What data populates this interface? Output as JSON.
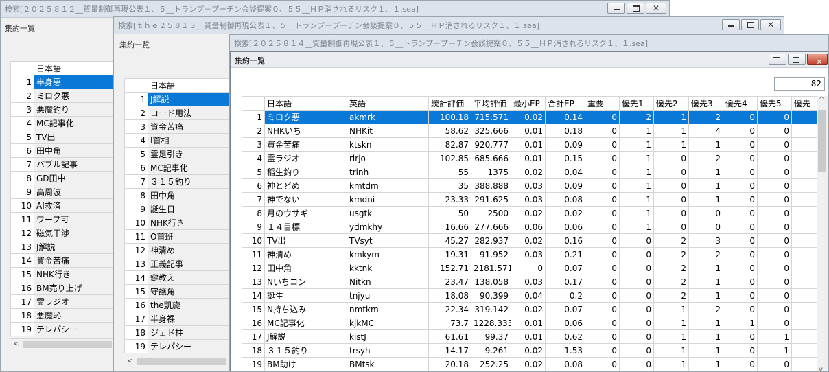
{
  "window1": {
    "title": "検索[２０２５８１２__質量制御再現公表１、５__トランプ－プーチン会談提案０、５５__ＨＰ消されるリスク１、１.sea]",
    "panel_title": "集約一覧",
    "col_header": "日本語",
    "rows": [
      {
        "n": "1",
        "ja": "半身悪"
      },
      {
        "n": "2",
        "ja": "ミロク悪"
      },
      {
        "n": "3",
        "ja": "悪魔釣り"
      },
      {
        "n": "4",
        "ja": "MC記事化"
      },
      {
        "n": "5",
        "ja": "TV出"
      },
      {
        "n": "6",
        "ja": "田中角"
      },
      {
        "n": "7",
        "ja": "バブル記事"
      },
      {
        "n": "8",
        "ja": "GD田中"
      },
      {
        "n": "9",
        "ja": "高周波"
      },
      {
        "n": "10",
        "ja": "AI救済"
      },
      {
        "n": "11",
        "ja": "ワープ可"
      },
      {
        "n": "12",
        "ja": "磁気干渉"
      },
      {
        "n": "13",
        "ja": "J解説"
      },
      {
        "n": "14",
        "ja": "資金苦痛"
      },
      {
        "n": "15",
        "ja": "NHK行き"
      },
      {
        "n": "16",
        "ja": "BM売り上げ"
      },
      {
        "n": "17",
        "ja": "霊ラジオ"
      },
      {
        "n": "18",
        "ja": "悪魔恥"
      },
      {
        "n": "19",
        "ja": "テレパシー"
      }
    ]
  },
  "window2": {
    "title": "検索[ｔｈｅ２５８１３__質量制御再現公表１、５__トランプ－プーチン会談提案０、５５__ＨＰ消されるリスク１、１.sea]",
    "panel_title": "集約一覧",
    "col_header": "日本語",
    "rows": [
      {
        "n": "1",
        "ja": "J解説"
      },
      {
        "n": "2",
        "ja": "コード用法"
      },
      {
        "n": "3",
        "ja": "資金苦痛"
      },
      {
        "n": "4",
        "ja": "I首相"
      },
      {
        "n": "5",
        "ja": "霊足引き"
      },
      {
        "n": "6",
        "ja": "MC記事化"
      },
      {
        "n": "7",
        "ja": "３１５釣り"
      },
      {
        "n": "8",
        "ja": "田中角"
      },
      {
        "n": "9",
        "ja": "誕生日"
      },
      {
        "n": "10",
        "ja": "NHK行き"
      },
      {
        "n": "11",
        "ja": "O首班"
      },
      {
        "n": "12",
        "ja": "神清め"
      },
      {
        "n": "13",
        "ja": "正義記事"
      },
      {
        "n": "14",
        "ja": "鍵教え"
      },
      {
        "n": "15",
        "ja": "守護角"
      },
      {
        "n": "16",
        "ja": "the凱旋"
      },
      {
        "n": "17",
        "ja": "半身裸"
      },
      {
        "n": "18",
        "ja": "ジェド柱"
      },
      {
        "n": "19",
        "ja": "テレパシー"
      }
    ]
  },
  "window3": {
    "title": "検索[２０２５８１４__質量制御再現公表１、５__トランプ－プーチン会談提案０、５５__ＨＰ消されるリスク１、１.sea]",
    "panel_title": "集約一覧",
    "count": "82",
    "headers": [
      "日本語",
      "英語",
      "統計評価",
      "平均評価",
      "最小EP",
      "合計EP",
      "重要",
      "優先1",
      "優先2",
      "優先3",
      "優先4",
      "優先5",
      "優先"
    ],
    "rows": [
      {
        "n": "1",
        "c": [
          "ミロク悪",
          "akmrk",
          "100.18",
          "715.571",
          "0.02",
          "0.14",
          "0",
          "2",
          "1",
          "2",
          "0",
          "0",
          ""
        ]
      },
      {
        "n": "2",
        "c": [
          "NHKいち",
          "NHKit",
          "58.62",
          "325.666",
          "0.01",
          "0.18",
          "0",
          "1",
          "1",
          "4",
          "0",
          "0",
          ""
        ]
      },
      {
        "n": "3",
        "c": [
          "資金苦痛",
          "ktskn",
          "82.87",
          "920.777",
          "0.01",
          "0.09",
          "0",
          "1",
          "1",
          "1",
          "0",
          "0",
          ""
        ]
      },
      {
        "n": "4",
        "c": [
          "霊ラジオ",
          "rirjo",
          "102.85",
          "685.666",
          "0.01",
          "0.15",
          "0",
          "1",
          "0",
          "2",
          "0",
          "0",
          ""
        ]
      },
      {
        "n": "5",
        "c": [
          "稲生釣り",
          "trinh",
          "55",
          "1375",
          "0.02",
          "0.04",
          "0",
          "1",
          "0",
          "1",
          "0",
          "0",
          ""
        ]
      },
      {
        "n": "6",
        "c": [
          "神とどめ",
          "kmtdm",
          "35",
          "388.888",
          "0.03",
          "0.09",
          "0",
          "1",
          "0",
          "1",
          "0",
          "0",
          ""
        ]
      },
      {
        "n": "7",
        "c": [
          "神でない",
          "kmdni",
          "23.33",
          "291.625",
          "0.03",
          "0.08",
          "0",
          "1",
          "0",
          "1",
          "0",
          "0",
          ""
        ]
      },
      {
        "n": "8",
        "c": [
          "月のウサギ",
          "usgtk",
          "50",
          "2500",
          "0.02",
          "0.02",
          "0",
          "1",
          "0",
          "0",
          "0",
          "0",
          ""
        ]
      },
      {
        "n": "9",
        "c": [
          "１４目標",
          "ydmkhy",
          "16.66",
          "277.666",
          "0.06",
          "0.06",
          "0",
          "1",
          "0",
          "0",
          "0",
          "0",
          ""
        ]
      },
      {
        "n": "10",
        "c": [
          "TV出",
          "TVsyt",
          "45.27",
          "282.937",
          "0.02",
          "0.16",
          "0",
          "0",
          "2",
          "3",
          "0",
          "0",
          ""
        ]
      },
      {
        "n": "11",
        "c": [
          "神清め",
          "kmkym",
          "19.31",
          "91.952",
          "0.03",
          "0.21",
          "0",
          "0",
          "2",
          "2",
          "0",
          "0",
          ""
        ]
      },
      {
        "n": "12",
        "c": [
          "田中角",
          "kktnk",
          "152.71",
          "2181.571",
          "0",
          "0.07",
          "0",
          "0",
          "2",
          "1",
          "0",
          "0",
          ""
        ]
      },
      {
        "n": "13",
        "c": [
          "Nいちコン",
          "Nitkn",
          "23.47",
          "138.058",
          "0.03",
          "0.17",
          "0",
          "0",
          "2",
          "1",
          "0",
          "0",
          ""
        ]
      },
      {
        "n": "14",
        "c": [
          "誕生",
          "tnjyu",
          "18.08",
          "90.399",
          "0.04",
          "0.2",
          "0",
          "0",
          "2",
          "1",
          "0",
          "0",
          ""
        ]
      },
      {
        "n": "15",
        "c": [
          "N持ち込み",
          "nmtkm",
          "22.34",
          "319.142",
          "0.02",
          "0.07",
          "0",
          "0",
          "1",
          "2",
          "0",
          "0",
          ""
        ]
      },
      {
        "n": "16",
        "c": [
          "MC記事化",
          "kjkMC",
          "73.7",
          "1228.333",
          "0.01",
          "0.06",
          "0",
          "0",
          "1",
          "1",
          "1",
          "0",
          ""
        ]
      },
      {
        "n": "17",
        "c": [
          "J解説",
          "kistJ",
          "61.61",
          "99.37",
          "0.01",
          "0.62",
          "0",
          "0",
          "1",
          "1",
          "0",
          "1",
          ""
        ]
      },
      {
        "n": "18",
        "c": [
          "３１５釣り",
          "trsyh",
          "14.17",
          "9.261",
          "0.02",
          "1.53",
          "0",
          "0",
          "1",
          "1",
          "0",
          "1",
          ""
        ]
      },
      {
        "n": "19",
        "c": [
          "BM助け",
          "BMtsk",
          "20.18",
          "252.25",
          "0.02",
          "0.08",
          "0",
          "0",
          "1",
          "1",
          "0",
          "0",
          ""
        ]
      }
    ]
  }
}
